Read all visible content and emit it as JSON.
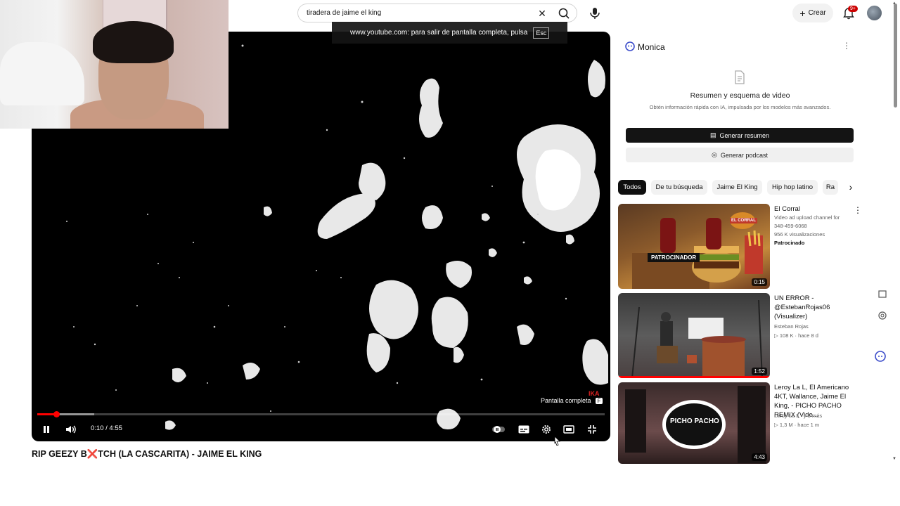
{
  "search": {
    "query": "tiradera de jaime el king"
  },
  "header": {
    "create_label": "Crear",
    "notif_count": "9+"
  },
  "fullscreen_toast": {
    "text": "www.youtube.com: para salir de pantalla completa, pulsa",
    "key": "Esc"
  },
  "player": {
    "tooltip": "Pantalla completa",
    "tooltip_key": "F",
    "time": "0:10 / 4:55",
    "progress": 0.034,
    "buffered": 0.1,
    "corner_label": "IKA"
  },
  "video": {
    "title": "RIP GEEZY B❌TCH (LA CASCARITA) - JAIME EL KING"
  },
  "monica": {
    "name": "Monica",
    "summary_title": "Resumen y esquema de video",
    "summary_desc": "Obtén información rápida con IA, impulsada por los modelos más avanzados.",
    "generate_summary": "Generar resumen",
    "generate_podcast": "Generar podcast"
  },
  "chips": [
    "Todos",
    "De tu búsqueda",
    "Jaime El King",
    "Hip hop latino",
    "Ra"
  ],
  "recommendations": [
    {
      "title": "El Corral",
      "meta1": "Video ad upload channel for",
      "meta2": "348-459-6068",
      "meta3": "956 K visualizaciones",
      "meta4": "Patrocinado",
      "duration": "0:15",
      "overlay": "PATROCINADOR",
      "brand": "EL CORRAL"
    },
    {
      "title": "UN ERROR - @EstebanRojas06 (Visualizer)",
      "meta1": "Esteban Rojas",
      "meta2": "▷ 108 K · hace 8 d",
      "duration": "1:52"
    },
    {
      "title": "Leroy La L, El Americano 4KT, Wallance, Jaime El King, - PICHO PACHO REMIX (Vide...",
      "meta1": "Leroy La L · y 3 más",
      "meta2": "▷ 1,3 M · hace 1 m",
      "duration": "4:43",
      "overlay": "PICHO PACHO"
    }
  ],
  "colors": {
    "accent": "#ff0000",
    "dark": "#0f0f0f",
    "chip": "#f2f2f2"
  }
}
